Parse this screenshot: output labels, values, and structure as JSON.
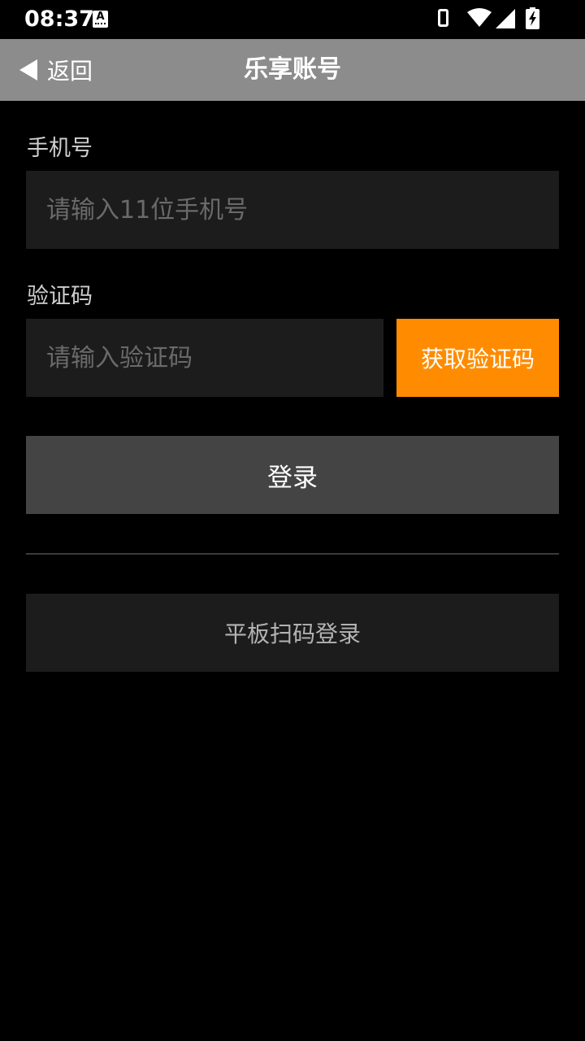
{
  "status_bar": {
    "time": "08:37",
    "notification_icon_letter": "A",
    "icons": [
      "phone-icon",
      "wifi-icon",
      "signal-icon",
      "battery-charging-icon"
    ]
  },
  "header": {
    "back_label": "返回",
    "title": "乐享账号"
  },
  "form": {
    "phone_label": "手机号",
    "phone_placeholder": "请输入11位手机号",
    "code_label": "验证码",
    "code_placeholder": "请输入验证码",
    "get_code_label": "获取验证码",
    "login_label": "登录",
    "scan_login_label": "平板扫码登录"
  },
  "colors": {
    "background": "#000000",
    "header": "#8c8c8c",
    "accent": "#ff8c00",
    "login_button": "#444444",
    "input_background": "#1c1c1c"
  }
}
